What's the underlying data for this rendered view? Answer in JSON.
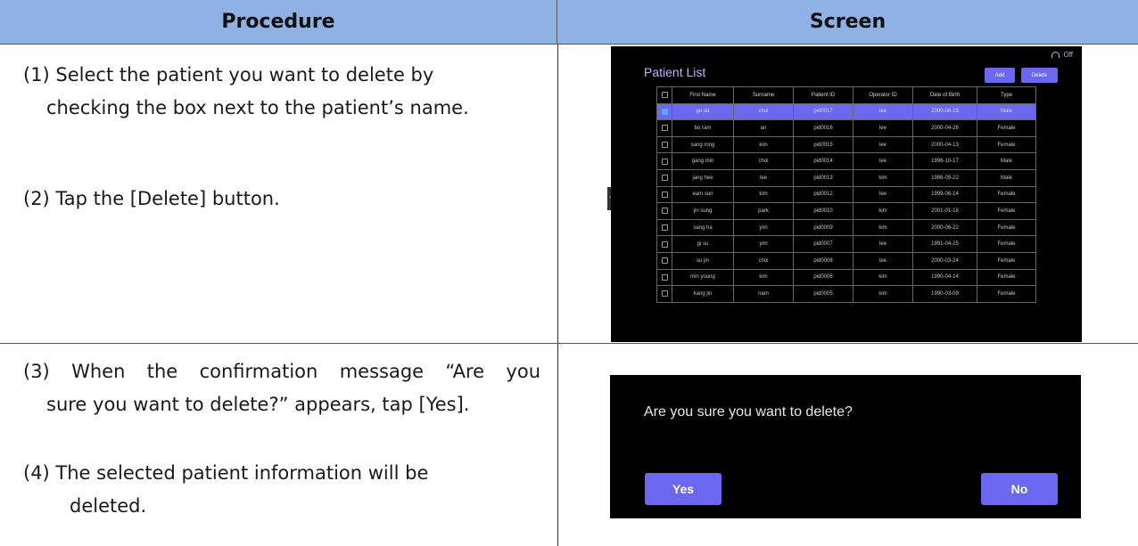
{
  "headers": {
    "procedure": "Procedure",
    "screen": "Screen"
  },
  "steps": {
    "s1_line1": "(1) Select the patient you want to delete by",
    "s1_line2": "checking the box next to the patient’s name.",
    "s2": "(2) Tap the [Delete] button.",
    "s3_line1": "(3) When the confirmation message “Are you",
    "s3_line2": "sure you want to delete?” appears, tap [Yes].",
    "s4_line1": "(4) The selected patient information will be",
    "s4_line2": "deleted."
  },
  "patient_screen": {
    "wifi_status": "Off",
    "title": "Patient List",
    "add_label": "Add",
    "delete_label": "Delete",
    "columns": [
      "First Name",
      "Surname",
      "Patient ID",
      "Operator ID",
      "Date of Birth",
      "Type"
    ],
    "rows": [
      {
        "checked": true,
        "first": "go da",
        "surname": "choi",
        "pid": "pid0017",
        "op": "lee",
        "dob": "2000-08-19",
        "type": "Male"
      },
      {
        "checked": false,
        "first": "bo ram",
        "surname": "an",
        "pid": "pid0016",
        "op": "lee",
        "dob": "2000-04-26",
        "type": "Female"
      },
      {
        "checked": false,
        "first": "sang rong",
        "surname": "kim",
        "pid": "pid0015",
        "op": "lee",
        "dob": "2000-04-13",
        "type": "Female"
      },
      {
        "checked": false,
        "first": "gang min",
        "surname": "choi",
        "pid": "pid0014",
        "op": "lee",
        "dob": "1996-10-17",
        "type": "Male"
      },
      {
        "checked": false,
        "first": "jang hee",
        "surname": "lee",
        "pid": "pid0013",
        "op": "kim",
        "dob": "1986-05-22",
        "type": "Male"
      },
      {
        "checked": false,
        "first": "eam sun",
        "surname": "kim",
        "pid": "pid0012",
        "op": "lee",
        "dob": "1999-06-14",
        "type": "Female"
      },
      {
        "checked": false,
        "first": "jin sung",
        "surname": "park",
        "pid": "pid0010",
        "op": "kim",
        "dob": "2001-01-18",
        "type": "Female"
      },
      {
        "checked": false,
        "first": "sang ha",
        "surname": "yim",
        "pid": "pid0009",
        "op": "kim",
        "dob": "2000-06-22",
        "type": "Female"
      },
      {
        "checked": false,
        "first": "gi su",
        "surname": "yim",
        "pid": "pid0007",
        "op": "lee",
        "dob": "1991-04-25",
        "type": "Female"
      },
      {
        "checked": false,
        "first": "su jin",
        "surname": "choi",
        "pid": "pid0008",
        "op": "lee",
        "dob": "2000-03-24",
        "type": "Female"
      },
      {
        "checked": false,
        "first": "min young",
        "surname": "kim",
        "pid": "pid0006",
        "op": "kim",
        "dob": "1990-04-14",
        "type": "Female"
      },
      {
        "checked": false,
        "first": "kang jin",
        "surname": "nam",
        "pid": "pid0005",
        "op": "kim",
        "dob": "1990-03-09",
        "type": "Female"
      }
    ]
  },
  "dialog": {
    "message": "Are you sure you want to delete?",
    "yes_label": "Yes",
    "no_label": "No"
  }
}
